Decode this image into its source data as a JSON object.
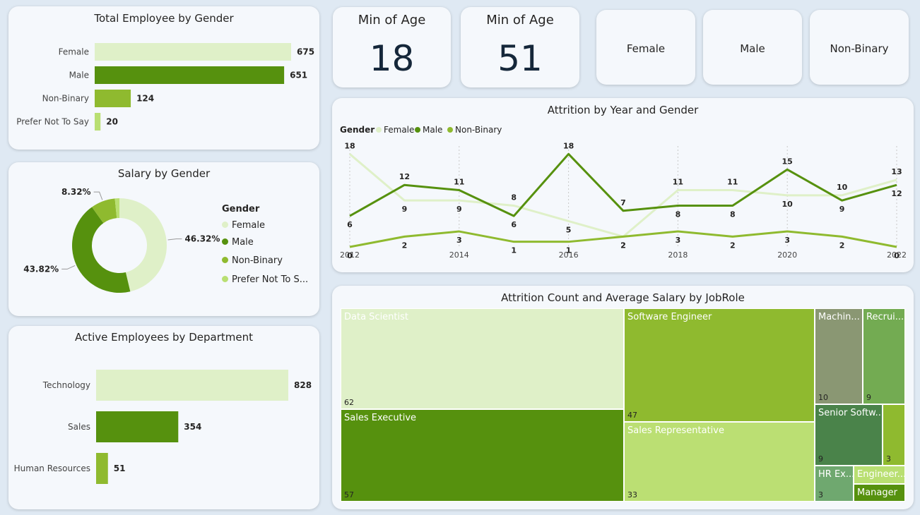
{
  "colors": {
    "female": "#dff0c8",
    "male": "#56910e",
    "nonbinary": "#8fba2f",
    "prefer": "#b9df72"
  },
  "kpis": [
    {
      "label": "Min of Age",
      "value": "18"
    },
    {
      "label": "Min of Age",
      "value": "51"
    }
  ],
  "slicers": [
    "Female",
    "Male",
    "Non-Binary"
  ],
  "gender_chart": {
    "title": "Total Employee by Gender"
  },
  "salary_chart": {
    "title": "Salary by Gender",
    "legend_title": "Gender",
    "legend": [
      "Female",
      "Male",
      "Non-Binary",
      "Prefer Not To S..."
    ]
  },
  "dept_chart": {
    "title": "Active Employees by Department"
  },
  "attrition_chart": {
    "title": "Attrition by Year and Gender",
    "legend_title": "Gender",
    "legend": [
      "Female",
      "Male",
      "Non-Binary"
    ]
  },
  "treemap": {
    "title": "Attrition Count and Average Salary by JobRole"
  },
  "chart_data": [
    {
      "type": "bar",
      "orientation": "horizontal",
      "title": "Total Employee by Gender",
      "categories": [
        "Female",
        "Male",
        "Non-Binary",
        "Prefer Not To Say"
      ],
      "values": [
        675,
        651,
        124,
        20
      ]
    },
    {
      "type": "pie",
      "style": "donut",
      "title": "Salary by Gender",
      "categories": [
        "Female",
        "Male",
        "Non-Binary",
        "Prefer Not To Say"
      ],
      "values": [
        46.32,
        43.82,
        8.32,
        1.54
      ],
      "labels": [
        "46.32%",
        "43.82%",
        "8.32%",
        ""
      ]
    },
    {
      "type": "bar",
      "orientation": "horizontal",
      "title": "Active Employees by Department",
      "categories": [
        "Technology",
        "Sales",
        "Human Resources"
      ],
      "values": [
        828,
        354,
        51
      ]
    },
    {
      "type": "line",
      "title": "Attrition by Year and Gender",
      "x": [
        2012,
        2013,
        2014,
        2015,
        2016,
        2017,
        2018,
        2019,
        2020,
        2021,
        2022
      ],
      "x_ticks": [
        "2012",
        "2014",
        "2016",
        "2018",
        "2020",
        "2022"
      ],
      "ylim": [
        0,
        19
      ],
      "series": [
        {
          "name": "Female",
          "values": [
            18,
            9,
            9,
            8,
            5,
            2,
            11,
            11,
            10,
            10,
            13
          ]
        },
        {
          "name": "Male",
          "values": [
            6,
            12,
            11,
            6,
            18,
            7,
            8,
            8,
            15,
            9,
            12
          ]
        },
        {
          "name": "Non-Binary",
          "values": [
            0,
            2,
            3,
            1,
            1,
            2,
            3,
            2,
            3,
            2,
            0
          ]
        }
      ]
    },
    {
      "type": "treemap",
      "title": "Attrition Count and Average Salary by JobRole",
      "items": [
        {
          "label": "Data Scientist",
          "value": 62
        },
        {
          "label": "Sales Executive",
          "value": 57
        },
        {
          "label": "Software Engineer",
          "value": 47
        },
        {
          "label": "Sales Representative",
          "value": 33
        },
        {
          "label": "Machin...",
          "value": 10
        },
        {
          "label": "Recrui...",
          "value": 9
        },
        {
          "label": "Senior Softw...",
          "value": 9
        },
        {
          "label": "",
          "value": 3
        },
        {
          "label": "HR Ex...",
          "value": 3
        },
        {
          "label": "Engineer...",
          "value": ""
        },
        {
          "label": "Manager",
          "value": ""
        }
      ]
    }
  ]
}
